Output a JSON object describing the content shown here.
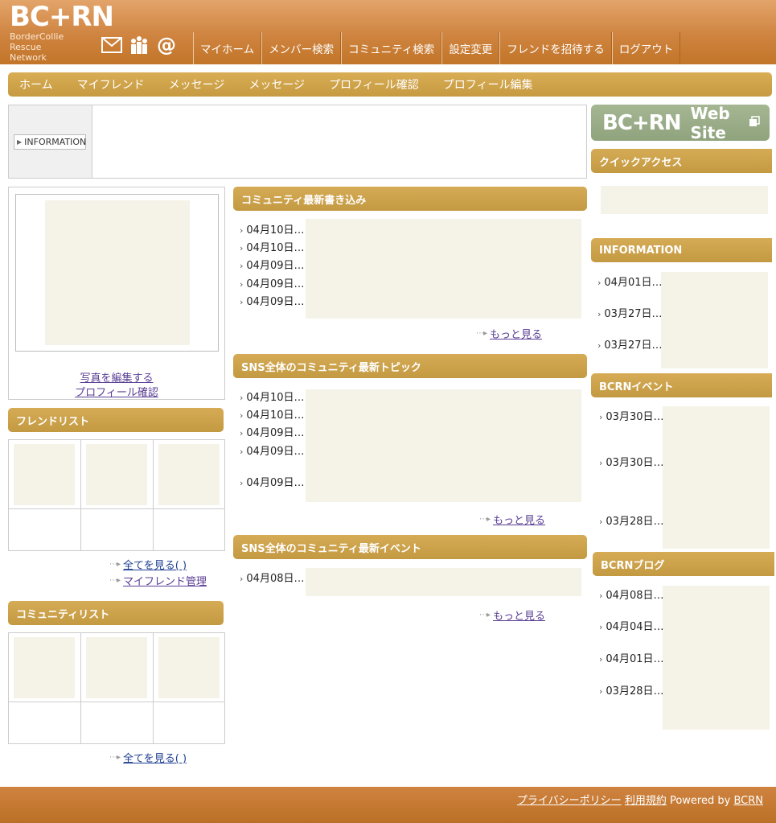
{
  "header": {
    "logo": "BC+RN",
    "logo_sub": [
      "BorderCollie",
      "Rescue",
      "Network"
    ],
    "icons": [
      "mail-icon",
      "people-icon",
      "at-icon"
    ],
    "nav": [
      "マイホーム",
      "メンバー検索",
      "コミュニティ検索",
      "設定変更",
      "フレンドを招待する",
      "ログアウト"
    ]
  },
  "subnav": [
    "ホーム",
    "マイフレンド",
    "メッセージ",
    "メッセージ",
    "プロフィール確認",
    "プロフィール編集"
  ],
  "info": {
    "button": "INFORMATION"
  },
  "left": {
    "photo_edit": "写真を編集する",
    "profile_check": "プロフィール確認",
    "friendlist_title": "フレンドリスト",
    "friend_view_all": "全てを見る( )",
    "friend_manage": "マイフレンド管理",
    "communitylist_title": "コミュニティリスト",
    "community_view_all": "全てを見る( )"
  },
  "center": {
    "sections": [
      {
        "title": "コミュニティ最新書き込み",
        "dates": [
          "04月10日…",
          "04月10日…",
          "04月09日…",
          "04月09日…",
          "04月09日…"
        ],
        "more": "もっと見る"
      },
      {
        "title": "SNS全体のコミュニティ最新トピック",
        "dates": [
          "04月10日…",
          "04月10日…",
          "04月09日…",
          "04月09日…",
          "04月09日…"
        ],
        "more": "もっと見る"
      },
      {
        "title": "SNS全体のコミュニティ最新イベント",
        "dates": [
          "04月08日…"
        ],
        "more": "もっと見る"
      }
    ]
  },
  "right": {
    "banner_logo": "BC+RN",
    "banner_text": "Web Site",
    "quick_access": "クイックアクセス",
    "information": {
      "title": "INFORMATION",
      "dates": [
        "04月01日…",
        "03月27日…",
        "03月27日…"
      ]
    },
    "events": {
      "title": "BCRNイベント",
      "dates": [
        "03月30日…",
        "03月30日…",
        "03月28日…"
      ]
    },
    "blog": {
      "title": "BCRNブログ",
      "dates": [
        "04月08日…",
        "04月04日…",
        "04月01日…",
        "03月28日…"
      ]
    }
  },
  "footer": {
    "privacy": "プライバシーポリシー",
    "terms": "利用規約",
    "powered": "Powered by",
    "brand": "BCRN"
  },
  "colors": {
    "header": "#cf8440",
    "gold": "#c9a048",
    "placeholder": "#f5f3e7",
    "banner": "#9aad88",
    "link_purple": "#5a3d93",
    "link_blue": "#1e3e92"
  }
}
